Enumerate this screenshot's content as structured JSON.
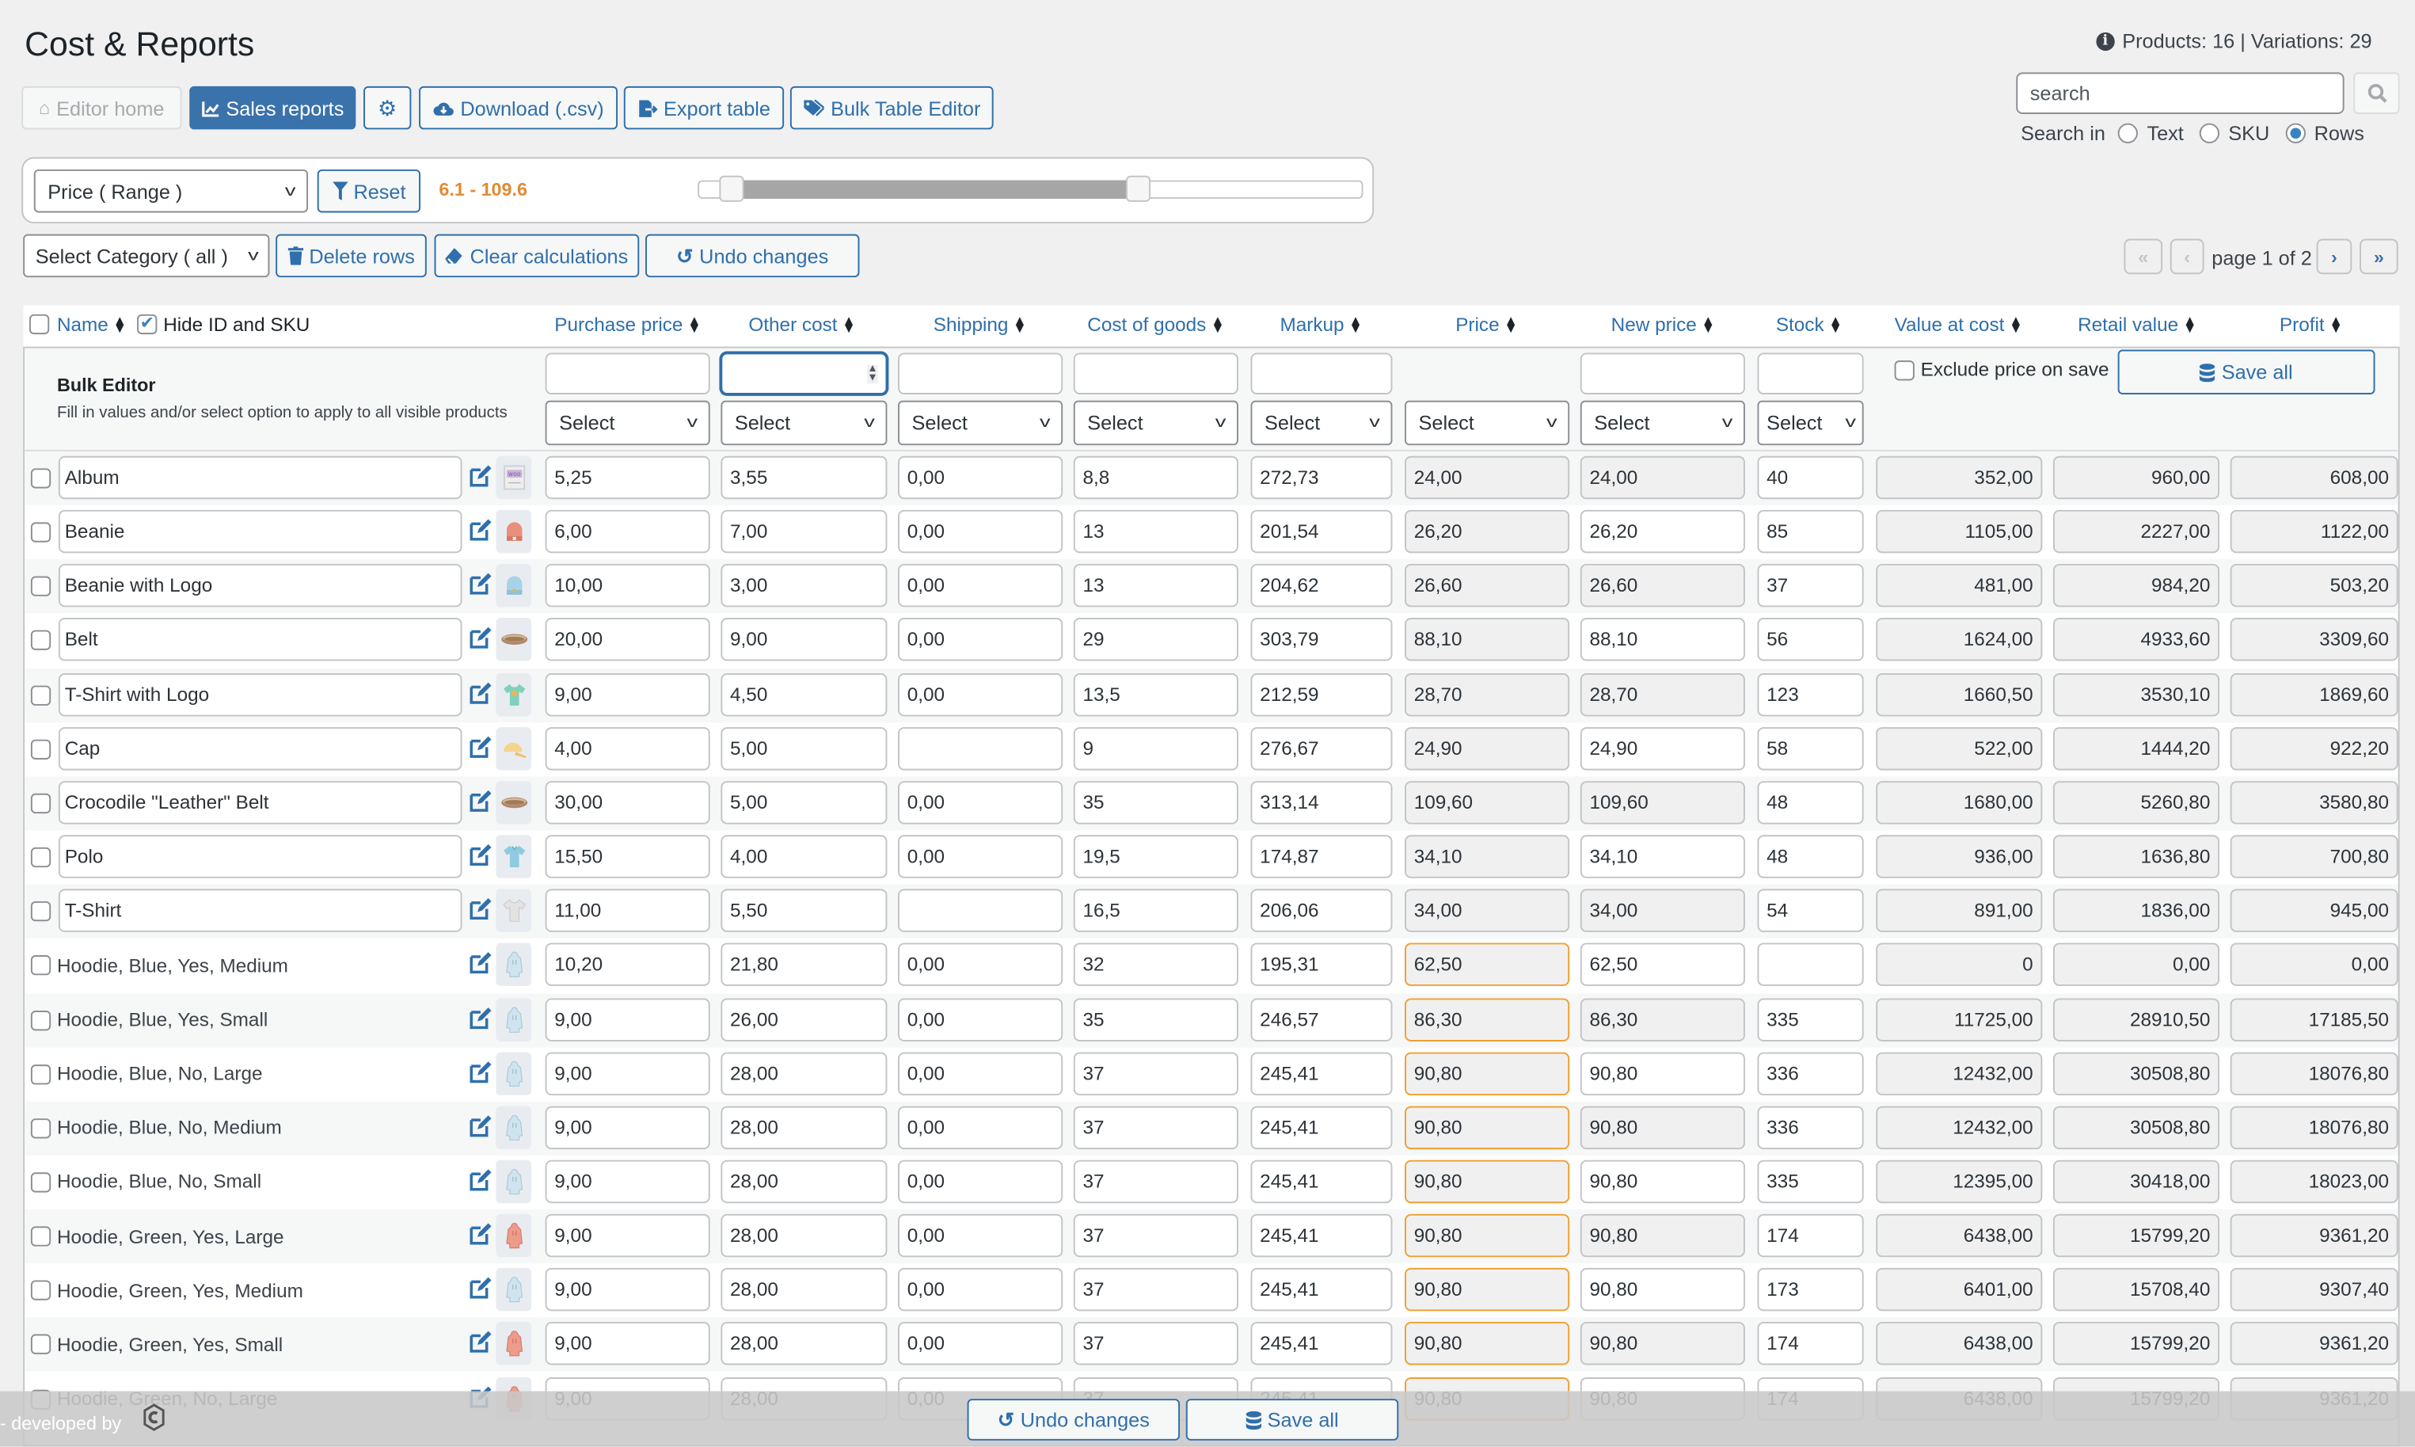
{
  "header": {
    "title": "Cost & Reports",
    "stats": "Products: 16 | Variations: 29"
  },
  "toolbar": {
    "editor_home": "Editor home",
    "sales_reports": "Sales reports",
    "download_csv": "Download (.csv)",
    "export_table": "Export table",
    "bulk_table_editor": "Bulk Table Editor"
  },
  "search": {
    "placeholder": "search",
    "search_in_label": "Search in",
    "options": [
      {
        "label": "Text",
        "selected": false
      },
      {
        "label": "SKU",
        "selected": false
      },
      {
        "label": "Rows",
        "selected": true
      }
    ]
  },
  "filter": {
    "field_select": "Price ( Range )",
    "reset_label": "Reset",
    "range_text": "6.1 - 109.6",
    "range_min": 6.1,
    "range_max": 109.6,
    "slider_low_fraction": 0.03,
    "slider_high_fraction": 0.67,
    "accent_color": "#e08b35"
  },
  "actions": {
    "category_select": "Select Category ( all )",
    "delete_rows": "Delete rows",
    "clear_calculations": "Clear calculations",
    "undo_changes": "Undo changes"
  },
  "pagination": {
    "label": "page 1 of 2",
    "current": 1,
    "total": 2
  },
  "table": {
    "name_header": "Name",
    "hide_id_sku_label": "Hide ID and SKU",
    "hide_id_sku_checked": true,
    "columns": [
      "Purchase price",
      "Other cost",
      "Shipping",
      "Cost of goods",
      "Markup",
      "Price",
      "New price",
      "Stock",
      "Value at cost",
      "Retail value",
      "Profit"
    ],
    "bulk_editor": {
      "title": "Bulk Editor",
      "subtitle": "Fill in values and/or select option to apply to all visible products",
      "select_placeholder": "Select",
      "exclude_price_label": "Exclude price on save",
      "save_all": "Save all"
    },
    "rows": [
      {
        "name": "Album",
        "thumb": "album",
        "type": "product",
        "purchase": "5,25",
        "other": "3,55",
        "shipping": "0,00",
        "cog": "8,8",
        "markup": "272,73",
        "price": "24,00",
        "new_price": "24,00",
        "stock": "40",
        "value_at_cost": "352,00",
        "retail_value": "960,00",
        "profit": "608,00"
      },
      {
        "name": "Beanie",
        "thumb": "beanie-red",
        "type": "product",
        "purchase": "6,00",
        "other": "7,00",
        "shipping": "0,00",
        "cog": "13",
        "markup": "201,54",
        "price": "26,20",
        "new_price": "26,20",
        "stock": "85",
        "value_at_cost": "1105,00",
        "retail_value": "2227,00",
        "profit": "1122,00"
      },
      {
        "name": "Beanie with Logo",
        "thumb": "beanie-blue",
        "type": "product",
        "purchase": "10,00",
        "other": "3,00",
        "shipping": "0,00",
        "cog": "13",
        "markup": "204,62",
        "price": "26,60",
        "new_price": "26,60",
        "stock": "37",
        "value_at_cost": "481,00",
        "retail_value": "984,20",
        "profit": "503,20"
      },
      {
        "name": "Belt",
        "thumb": "belt",
        "type": "product",
        "purchase": "20,00",
        "other": "9,00",
        "shipping": "0,00",
        "cog": "29",
        "markup": "303,79",
        "price": "88,10",
        "new_price": "88,10",
        "stock": "56",
        "value_at_cost": "1624,00",
        "retail_value": "4933,60",
        "profit": "3309,60"
      },
      {
        "name": "T-Shirt with Logo",
        "thumb": "tshirt-green",
        "type": "product",
        "purchase": "9,00",
        "other": "4,50",
        "shipping": "0,00",
        "cog": "13,5",
        "markup": "212,59",
        "price": "28,70",
        "new_price": "28,70",
        "stock": "123",
        "value_at_cost": "1660,50",
        "retail_value": "3530,10",
        "profit": "1869,60"
      },
      {
        "name": "Cap",
        "thumb": "cap",
        "type": "product",
        "purchase": "4,00",
        "other": "5,00",
        "shipping": "",
        "cog": "9",
        "markup": "276,67",
        "price": "24,90",
        "new_price": "24,90",
        "stock": "58",
        "value_at_cost": "522,00",
        "retail_value": "1444,20",
        "profit": "922,20"
      },
      {
        "name": "Crocodile \"Leather\" Belt",
        "thumb": "belt",
        "type": "product",
        "purchase": "30,00",
        "other": "5,00",
        "shipping": "0,00",
        "cog": "35",
        "markup": "313,14",
        "price": "109,60",
        "new_price": "109,60",
        "stock": "48",
        "value_at_cost": "1680,00",
        "retail_value": "5260,80",
        "profit": "3580,80"
      },
      {
        "name": "Polo",
        "thumb": "polo",
        "type": "product",
        "purchase": "15,50",
        "other": "4,00",
        "shipping": "0,00",
        "cog": "19,5",
        "markup": "174,87",
        "price": "34,10",
        "new_price": "34,10",
        "stock": "48",
        "value_at_cost": "936,00",
        "retail_value": "1636,80",
        "profit": "700,80"
      },
      {
        "name": "T-Shirt",
        "thumb": "tshirt-gray",
        "type": "product",
        "purchase": "11,00",
        "other": "5,50",
        "shipping": "",
        "cog": "16,5",
        "markup": "206,06",
        "price": "34,00",
        "new_price": "34,00",
        "stock": "54",
        "value_at_cost": "891,00",
        "retail_value": "1836,00",
        "profit": "945,00"
      },
      {
        "name": "Hoodie, Blue, Yes, Medium",
        "thumb": "hoodie-blue",
        "type": "variation",
        "purchase": "10,20",
        "other": "21,80",
        "shipping": "0,00",
        "cog": "32",
        "markup": "195,31",
        "price": "62,50",
        "new_price": "62,50",
        "stock": "",
        "value_at_cost": "0",
        "retail_value": "0,00",
        "profit": "0,00"
      },
      {
        "name": "Hoodie, Blue, Yes, Small",
        "thumb": "hoodie-blue",
        "type": "variation",
        "purchase": "9,00",
        "other": "26,00",
        "shipping": "0,00",
        "cog": "35",
        "markup": "246,57",
        "price": "86,30",
        "new_price": "86,30",
        "stock": "335",
        "value_at_cost": "11725,00",
        "retail_value": "28910,50",
        "profit": "17185,50"
      },
      {
        "name": "Hoodie, Blue, No, Large",
        "thumb": "hoodie-blue",
        "type": "variation",
        "purchase": "9,00",
        "other": "28,00",
        "shipping": "0,00",
        "cog": "37",
        "markup": "245,41",
        "price": "90,80",
        "new_price": "90,80",
        "stock": "336",
        "value_at_cost": "12432,00",
        "retail_value": "30508,80",
        "profit": "18076,80"
      },
      {
        "name": "Hoodie, Blue, No, Medium",
        "thumb": "hoodie-blue",
        "type": "variation",
        "purchase": "9,00",
        "other": "28,00",
        "shipping": "0,00",
        "cog": "37",
        "markup": "245,41",
        "price": "90,80",
        "new_price": "90,80",
        "stock": "336",
        "value_at_cost": "12432,00",
        "retail_value": "30508,80",
        "profit": "18076,80"
      },
      {
        "name": "Hoodie, Blue, No, Small",
        "thumb": "hoodie-blue",
        "type": "variation",
        "purchase": "9,00",
        "other": "28,00",
        "shipping": "0,00",
        "cog": "37",
        "markup": "245,41",
        "price": "90,80",
        "new_price": "90,80",
        "stock": "335",
        "value_at_cost": "12395,00",
        "retail_value": "30418,00",
        "profit": "18023,00"
      },
      {
        "name": "Hoodie, Green, Yes, Large",
        "thumb": "hoodie-red",
        "type": "variation",
        "purchase": "9,00",
        "other": "28,00",
        "shipping": "0,00",
        "cog": "37",
        "markup": "245,41",
        "price": "90,80",
        "new_price": "90,80",
        "stock": "174",
        "value_at_cost": "6438,00",
        "retail_value": "15799,20",
        "profit": "9361,20"
      },
      {
        "name": "Hoodie, Green, Yes, Medium",
        "thumb": "hoodie-blue",
        "type": "variation",
        "purchase": "9,00",
        "other": "28,00",
        "shipping": "0,00",
        "cog": "37",
        "markup": "245,41",
        "price": "90,80",
        "new_price": "90,80",
        "stock": "173",
        "value_at_cost": "6401,00",
        "retail_value": "15708,40",
        "profit": "9307,40"
      },
      {
        "name": "Hoodie, Green, Yes, Small",
        "thumb": "hoodie-red",
        "type": "variation",
        "purchase": "9,00",
        "other": "28,00",
        "shipping": "0,00",
        "cog": "37",
        "markup": "245,41",
        "price": "90,80",
        "new_price": "90,80",
        "stock": "174",
        "value_at_cost": "6438,00",
        "retail_value": "15799,20",
        "profit": "9361,20"
      },
      {
        "name": "Hoodie, Green, No, Large",
        "thumb": "hoodie-red",
        "type": "variation",
        "purchase": "9,00",
        "other": "28,00",
        "shipping": "0,00",
        "cog": "37",
        "markup": "245,41",
        "price": "90,80",
        "new_price": "90,80",
        "stock": "174",
        "value_at_cost": "6438,00",
        "retail_value": "15799,20",
        "profit": "9361,20"
      }
    ]
  },
  "footer": {
    "developed_by": "- developed by",
    "undo_changes": "Undo changes",
    "save_all": "Save all"
  },
  "colors": {
    "accent": "#3a72ab",
    "link": "#2f6fab",
    "variation_price_border": "#f0a030"
  }
}
